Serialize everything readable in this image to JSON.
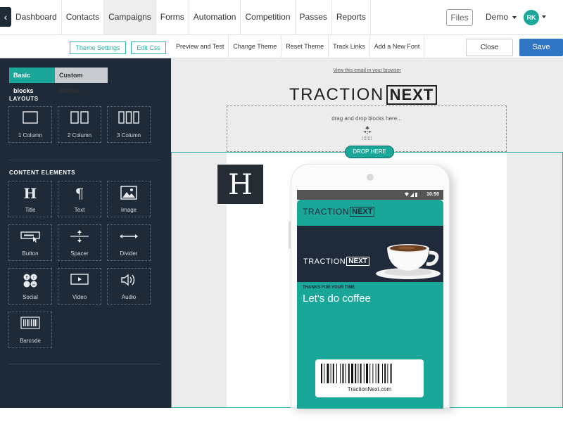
{
  "topnav": {
    "back_icon": "chevron-left-icon",
    "tabs": [
      {
        "label": "Dashboard"
      },
      {
        "label": "Contacts"
      },
      {
        "label": "Campaigns",
        "active": true
      },
      {
        "label": "Forms"
      },
      {
        "label": "Automation"
      },
      {
        "label": "Competition"
      },
      {
        "label": "Passes"
      },
      {
        "label": "Reports"
      }
    ],
    "files_label": "Files",
    "account_label": "Demo",
    "avatar_initials": "RK"
  },
  "toolbar": {
    "theme_settings": "Theme Settings",
    "edit_css": "Edit Css",
    "links": [
      "Preview and Test",
      "Change Theme",
      "Reset Theme",
      "Track Links",
      "Add a New Font"
    ],
    "close": "Close",
    "save": "Save"
  },
  "sidebar": {
    "tabs": {
      "basic": "Basic blocks",
      "custom": "Custom blocks"
    },
    "layouts_title": "LAYOUTS",
    "layouts": [
      {
        "label": "1 Column",
        "icon": "one-column-icon"
      },
      {
        "label": "2 Column",
        "icon": "two-column-icon"
      },
      {
        "label": "3 Column",
        "icon": "three-column-icon"
      }
    ],
    "content_title": "CONTENT ELEMENTS",
    "content": [
      {
        "label": "Title",
        "icon": "heading-icon"
      },
      {
        "label": "Text",
        "icon": "paragraph-icon"
      },
      {
        "label": "Image",
        "icon": "image-icon"
      },
      {
        "label": "Button",
        "icon": "button-icon"
      },
      {
        "label": "Spacer",
        "icon": "spacer-icon"
      },
      {
        "label": "Divider",
        "icon": "divider-icon"
      },
      {
        "label": "Social",
        "icon": "social-icon"
      },
      {
        "label": "Video",
        "icon": "video-icon"
      },
      {
        "label": "Audio",
        "icon": "audio-icon"
      },
      {
        "label": "Barcode",
        "icon": "barcode-icon"
      }
    ]
  },
  "canvas": {
    "view_link": "View this email in your browser",
    "logo": {
      "left": "TRACTION",
      "right": "NEXT"
    },
    "dropzone_text": "drag and drop blocks here...",
    "drop_here": "DROP HERE",
    "dragged_block_glyph": "H",
    "phone": {
      "time": "10:50",
      "pass_logo": {
        "left": "TRACTION",
        "right": "NEXT"
      },
      "banner_logo": {
        "left": "TRACTION",
        "right": "NEXT"
      },
      "subtitle": "THANKS FOR YOUR TIME",
      "headline": "Let's do coffee",
      "barcode_text": "TractionNext.com"
    }
  },
  "colors": {
    "sidebar_bg": "#1e2a38",
    "accent_teal": "#1ba69a",
    "save_blue": "#2f76c5",
    "canvas_bg": "#ececec"
  }
}
